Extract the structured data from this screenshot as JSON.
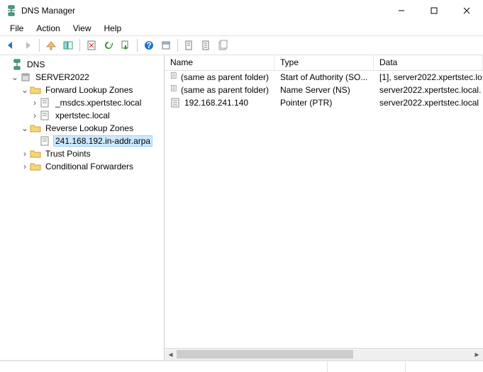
{
  "window": {
    "title": "DNS Manager"
  },
  "menu": {
    "file": "File",
    "action": "Action",
    "view": "View",
    "help": "Help"
  },
  "tree": {
    "root": "DNS",
    "server": "SERVER2022",
    "fwd": "Forward Lookup Zones",
    "fwd_items": [
      "_msdcs.xpertstec.local",
      "xpertstec.local"
    ],
    "rev": "Reverse Lookup Zones",
    "rev_items": [
      "241.168.192.in-addr.arpa"
    ],
    "tp": "Trust Points",
    "cf": "Conditional Forwarders"
  },
  "list": {
    "columns": {
      "name": "Name",
      "type": "Type",
      "data": "Data"
    },
    "rows": [
      {
        "name": "(same as parent folder)",
        "type": "Start of Authority (SO...",
        "data": "[1], server2022.xpertstec.lo..."
      },
      {
        "name": "(same as parent folder)",
        "type": "Name Server (NS)",
        "data": "server2022.xpertstec.local."
      },
      {
        "name": "192.168.241.140",
        "type": "Pointer (PTR)",
        "data": "server2022.xpertstec.local"
      }
    ]
  }
}
